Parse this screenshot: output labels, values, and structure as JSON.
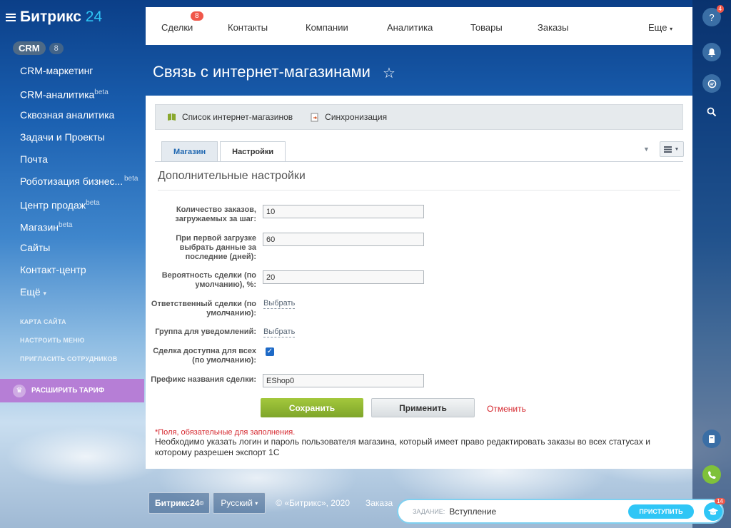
{
  "sidebar": {
    "logo_main": "Битрикс",
    "logo_num": "24",
    "crm_label": "CRM",
    "crm_count": "8",
    "items": [
      {
        "label": "CRM-маркетинг",
        "beta": ""
      },
      {
        "label": "CRM-аналитика",
        "beta": "beta"
      },
      {
        "label": "Сквозная аналитика",
        "beta": ""
      },
      {
        "label": "Задачи и Проекты",
        "beta": ""
      },
      {
        "label": "Почта",
        "beta": ""
      },
      {
        "label": "Роботизация бизнес...",
        "beta": "beta"
      },
      {
        "label": "Центр продаж",
        "beta": "beta"
      },
      {
        "label": "Магазин",
        "beta": "beta"
      },
      {
        "label": "Сайты",
        "beta": ""
      },
      {
        "label": "Контакт-центр",
        "beta": ""
      },
      {
        "label": "Ещё",
        "beta": ""
      }
    ],
    "more_caret": "▾",
    "links": [
      "КАРТА САЙТА",
      "НАСТРОИТЬ МЕНЮ",
      "ПРИГЛАСИТЬ СОТРУДНИКОВ"
    ],
    "upgrade_label": "РАСШИРИТЬ ТАРИФ"
  },
  "topnav": {
    "items": [
      "Сделки",
      "Контакты",
      "Компании",
      "Аналитика",
      "Товары",
      "Заказы",
      "Еще"
    ],
    "deals_badge": "8",
    "more_caret": "▾"
  },
  "rail": {
    "help_badge": "4"
  },
  "page": {
    "title": "Связь с интернет-магазинами",
    "star": "☆"
  },
  "toolbar": {
    "shop_list": "Список интернет-магазинов",
    "sync": "Синхронизация"
  },
  "tabs": {
    "shop": "Магазин",
    "settings": "Настройки"
  },
  "section": {
    "title": "Дополнительные настройки"
  },
  "form": {
    "orders_per_step_label": "Количество заказов, загружаемых за шаг:",
    "orders_per_step_value": "10",
    "first_load_label": "При первой загрузке выбрать данные за последние (дней):",
    "first_load_value": "60",
    "probability_label": "Вероятность сделки (по умолчанию), %:",
    "probability_value": "20",
    "responsible_label": "Ответственный сделки (по умолчанию):",
    "responsible_link": "Выбрать",
    "notify_group_label": "Группа для уведомлений:",
    "notify_group_link": "Выбрать",
    "available_all_label": "Сделка доступна для всех (по умолчанию):",
    "available_all_checked": true,
    "prefix_label": "Префикс названия сделки:",
    "prefix_value": "EShop0"
  },
  "buttons": {
    "save": "Сохранить",
    "apply": "Применить",
    "cancel": "Отменить"
  },
  "notes": {
    "required": "*Поля, обязательные для заполнения.",
    "main": "Необходимо указать логин и пароль пользователя магазина, который имеет право редактировать заказы во всех статусах и которому разрешен экспорт 1С"
  },
  "footer": {
    "logo": "Битрикс24",
    "logo_mark": "©",
    "lang": "Русский",
    "lang_caret": "▾",
    "copyright": "© «Битрикс», 2020",
    "order": "Заказа"
  },
  "taskbar": {
    "label": "ЗАДАНИЕ:",
    "value": "Вступление",
    "button": "ПРИСТУПИТЬ",
    "badge": "14"
  }
}
